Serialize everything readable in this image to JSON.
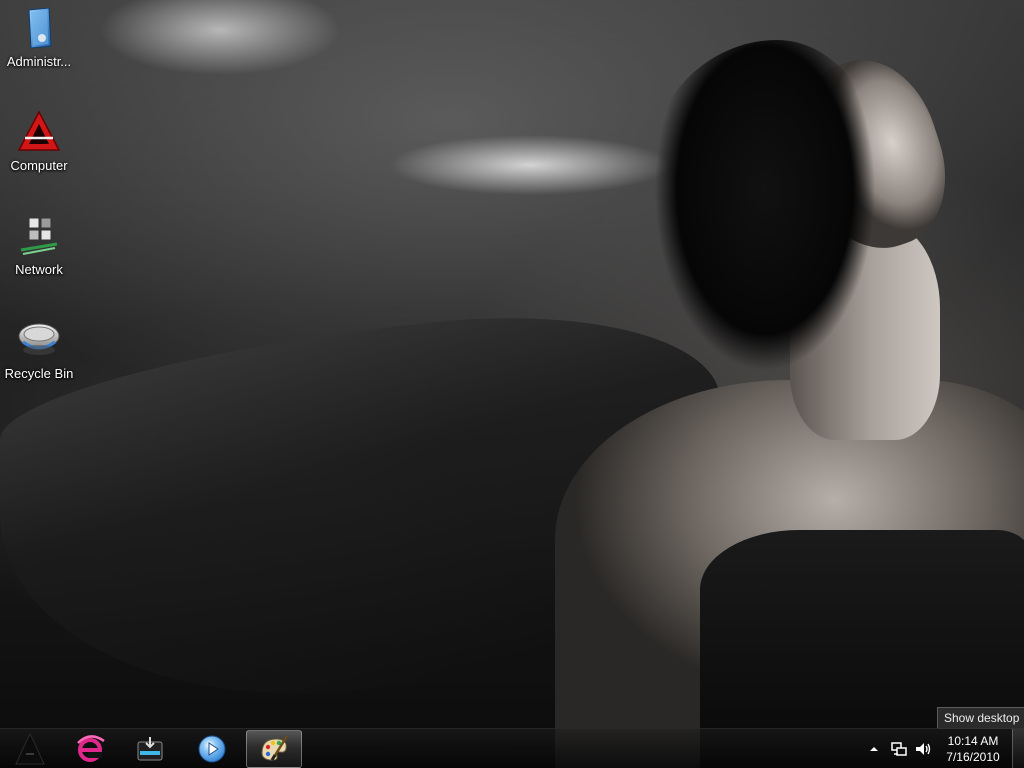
{
  "desktop": {
    "icons": [
      {
        "label": "Administr...",
        "icon": "user-folder-icon"
      },
      {
        "label": "Computer",
        "icon": "computer-icon"
      },
      {
        "label": "Network",
        "icon": "network-icon"
      },
      {
        "label": "Recycle Bin",
        "icon": "recycle-bin-icon"
      }
    ]
  },
  "taskbar": {
    "pinned": [
      {
        "icon": "start-orb-icon"
      },
      {
        "icon": "internet-explorer-icon"
      },
      {
        "icon": "windows-explorer-icon"
      },
      {
        "icon": "media-player-icon"
      },
      {
        "icon": "paint-icon",
        "active": true
      }
    ],
    "tray": {
      "icons": [
        "show-hidden-icons-icon",
        "network-status-icon",
        "volume-icon"
      ],
      "time": "10:14 AM",
      "date": "7/16/2010"
    },
    "show_desktop_tooltip": "Show desktop"
  },
  "colors": {
    "ie_accent": "#e0288c",
    "paint_palette": "#e8d9b0",
    "media_player": "#2a7fd4"
  }
}
